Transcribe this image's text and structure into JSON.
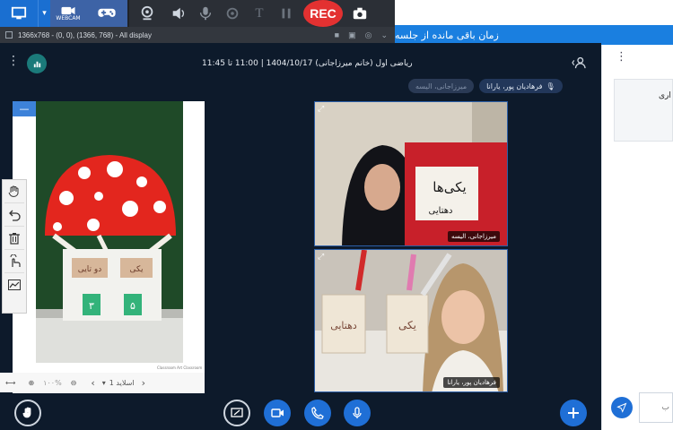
{
  "recorder": {
    "webcam_label": "WEBCAM",
    "rec_label": "REC",
    "t_label": "T",
    "info_text": "1366x768 - (0, 0), (1366, 768) - All display"
  },
  "banner": {
    "time_remaining_text": "زمان باقی مانده از جلسه"
  },
  "header": {
    "title": "ریاضی اول (خانم میرزاجانی) 1404/10/17 | 11:00 تا 11:45"
  },
  "chips": [
    {
      "label": "میرزاجانی، الیسه",
      "state": "muted"
    },
    {
      "label": "فرهادیان پور، یارانا",
      "state": "active"
    }
  ],
  "slide": {
    "min_label": "—",
    "card_left": "دو تایی",
    "card_right": "یکی",
    "number_left": "۳",
    "number_right": "۵",
    "credit": "Classroom Art Classroom",
    "zoom_label": "۱۰۰%",
    "slide_label": "اسلاید 1"
  },
  "videos": [
    {
      "name": "میرزاجانی، الیسه",
      "sign_text_1": "یکی‌ها",
      "sign_text_2": "دهتایی"
    },
    {
      "name": "فرهادیان پور، یارانا",
      "cup_text_1": "دهتایی",
      "cup_text_2": "یکی"
    }
  ],
  "chat": {
    "card_text": "اری",
    "input_placeholder": "ب"
  },
  "colors": {
    "accent": "#1f6fd6",
    "rec": "#e33131",
    "background": "#0d1a2b",
    "banner": "#1a7fe0"
  }
}
